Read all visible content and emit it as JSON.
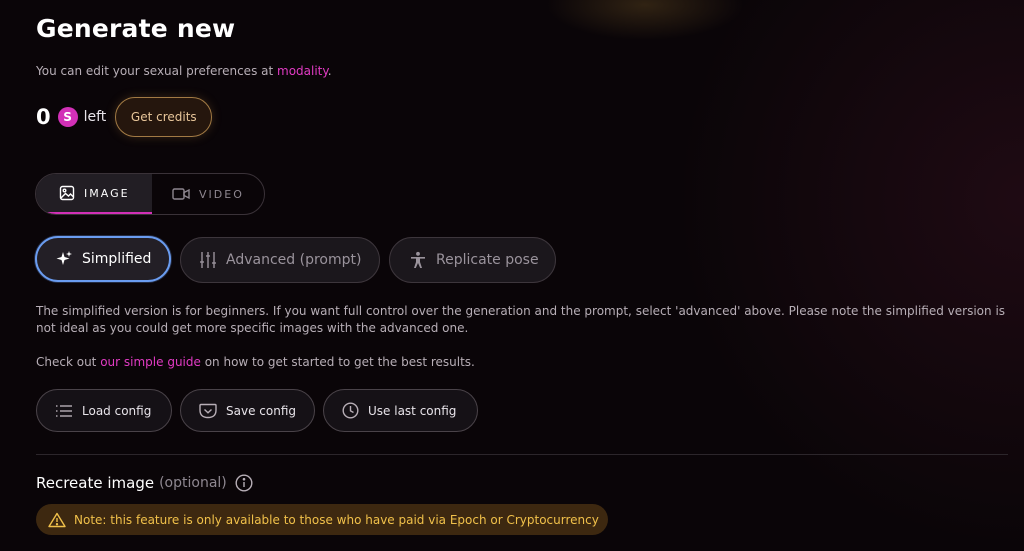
{
  "header": {
    "title": "Generate new",
    "subtitle_prefix": "You can edit your sexual preferences at ",
    "subtitle_link": "modality",
    "subtitle_suffix": "."
  },
  "credits": {
    "count": "0",
    "coin_symbol": "S",
    "left_label": "left",
    "get_credits_label": "Get credits"
  },
  "media_tabs": [
    {
      "label": "IMAGE",
      "icon": "image-icon",
      "active": true
    },
    {
      "label": "VIDEO",
      "icon": "video-icon",
      "active": false
    }
  ],
  "modes": [
    {
      "label": "Simplified",
      "icon": "sparkle-icon",
      "active": true
    },
    {
      "label": "Advanced (prompt)",
      "icon": "sliders-icon",
      "active": false
    },
    {
      "label": "Replicate pose",
      "icon": "person-icon",
      "active": false
    }
  ],
  "description": "The simplified version is for beginners. If you want full control over the generation and the prompt, select 'advanced' above. Please note the simplified version is not ideal as you could get more specific images with the advanced one.",
  "guide": {
    "prefix": "Check out ",
    "link": "our simple guide",
    "suffix": " on how to get started to get the best results."
  },
  "config_buttons": {
    "load": "Load config",
    "save": "Save config",
    "last": "Use last config"
  },
  "recreate": {
    "title": "Recreate image",
    "optional": "(optional)",
    "warning": "Note: this feature is only available to those who have paid via Epoch or Cryptocurrency"
  },
  "colors": {
    "accent": "#d230b7",
    "link": "#e23bc4",
    "selected_border": "#6a9cf0",
    "warning_bg": "#3d2810",
    "warning_text": "#f0c04a"
  }
}
